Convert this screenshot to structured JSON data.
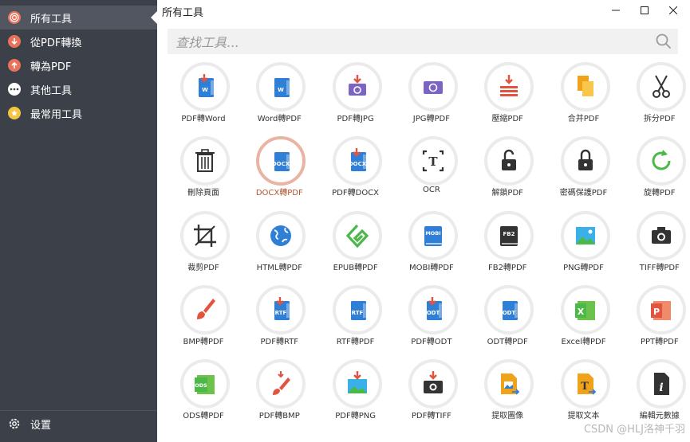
{
  "sidebar": {
    "items": [
      {
        "label": "所有工具",
        "icon": "target-icon",
        "color": "#e8735a",
        "active": true
      },
      {
        "label": "從PDF轉換",
        "icon": "arrow-down-icon",
        "color": "#e8735a"
      },
      {
        "label": "轉為PDF",
        "icon": "arrow-up-icon",
        "color": "#e8735a"
      },
      {
        "label": "其他工具",
        "icon": "more-icon",
        "color": "#ffffff"
      },
      {
        "label": "最常用工具",
        "icon": "star-icon",
        "color": "#f5c542"
      }
    ],
    "settings_label": "设置"
  },
  "window": {
    "title": "所有工具"
  },
  "search": {
    "placeholder": "查找工具..."
  },
  "tools": [
    {
      "label": "PDF轉Word",
      "icon": "pdf-to-word-icon"
    },
    {
      "label": "Word轉PDF",
      "icon": "word-to-pdf-icon"
    },
    {
      "label": "PDF轉JPG",
      "icon": "pdf-to-jpg-icon"
    },
    {
      "label": "JPG轉PDF",
      "icon": "jpg-to-pdf-icon"
    },
    {
      "label": "壓縮PDF",
      "icon": "compress-icon"
    },
    {
      "label": "合并PDF",
      "icon": "merge-icon"
    },
    {
      "label": "拆分PDF",
      "icon": "scissors-icon"
    },
    {
      "label": "刪除頁面",
      "icon": "trash-icon"
    },
    {
      "label": "DOCX轉PDF",
      "icon": "docx-to-pdf-icon",
      "selected": true
    },
    {
      "label": "PDF轉DOCX",
      "icon": "pdf-to-docx-icon"
    },
    {
      "label": "OCR",
      "icon": "ocr-icon"
    },
    {
      "label": "解鎖PDF",
      "icon": "unlock-icon"
    },
    {
      "label": "密碼保護PDF",
      "icon": "lock-icon"
    },
    {
      "label": "旋轉PDF",
      "icon": "rotate-icon"
    },
    {
      "label": "裁剪PDF",
      "icon": "crop-icon"
    },
    {
      "label": "HTML轉PDF",
      "icon": "globe-icon"
    },
    {
      "label": "EPUB轉PDF",
      "icon": "epub-icon"
    },
    {
      "label": "MOBI轉PDF",
      "icon": "mobi-book-icon"
    },
    {
      "label": "FB2轉PDF",
      "icon": "fb2-book-icon"
    },
    {
      "label": "PNG轉PDF",
      "icon": "png-image-icon"
    },
    {
      "label": "TIFF轉PDF",
      "icon": "camera-icon"
    },
    {
      "label": "BMP轉PDF",
      "icon": "brush-icon"
    },
    {
      "label": "PDF轉RTF",
      "icon": "pdf-to-rtf-icon"
    },
    {
      "label": "RTF轉PDF",
      "icon": "rtf-to-pdf-icon"
    },
    {
      "label": "PDF轉ODT",
      "icon": "pdf-to-odt-icon"
    },
    {
      "label": "ODT轉PDF",
      "icon": "odt-to-pdf-icon"
    },
    {
      "label": "Excel轉PDF",
      "icon": "excel-icon"
    },
    {
      "label": "PPT轉PDF",
      "icon": "ppt-icon"
    },
    {
      "label": "ODS轉PDF",
      "icon": "ods-icon"
    },
    {
      "label": "PDF轉BMP",
      "icon": "pdf-to-bmp-icon"
    },
    {
      "label": "PDF轉PNG",
      "icon": "pdf-to-png-icon"
    },
    {
      "label": "PDF轉TIFF",
      "icon": "pdf-to-tiff-icon"
    },
    {
      "label": "提取圖像",
      "icon": "extract-image-icon"
    },
    {
      "label": "提取文本",
      "icon": "extract-text-icon"
    },
    {
      "label": "編輯元數據",
      "icon": "metadata-icon"
    }
  ],
  "watermark": "CSDN @HLJ洛神千羽"
}
